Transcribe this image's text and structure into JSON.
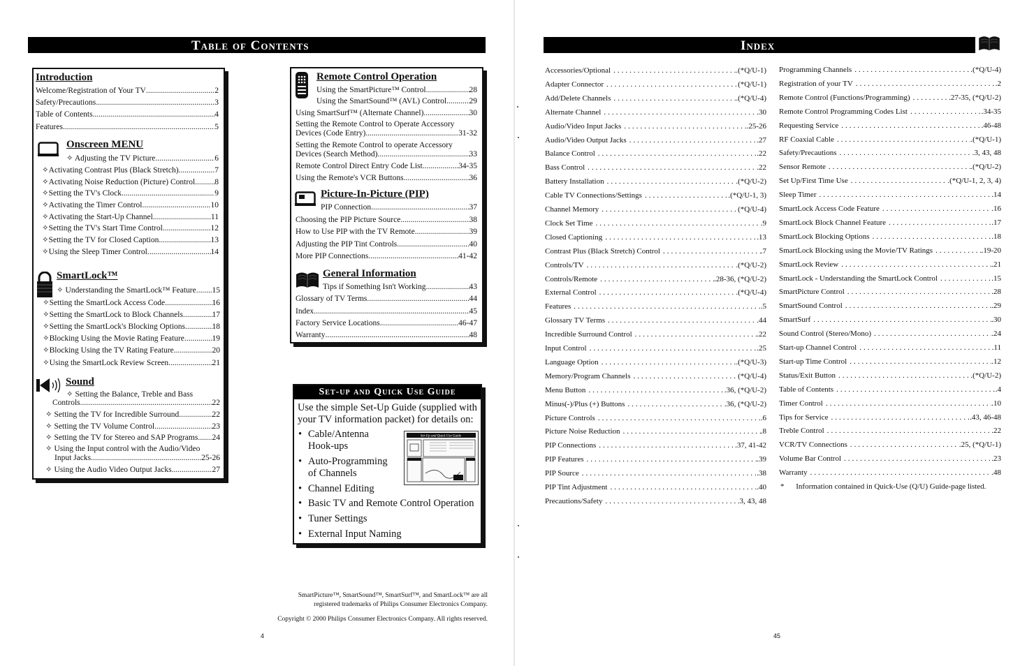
{
  "left_page": {
    "title": "Table of Contents",
    "page_number": "4",
    "sections": {
      "introduction": {
        "heading": "Introduction",
        "items": [
          {
            "label": "Welcome/Registration of Your TV",
            "page": "2"
          },
          {
            "label": "Safety/Precautions ",
            "page": "3"
          },
          {
            "label": "Table of Contents",
            "page": "4"
          },
          {
            "label": "Features",
            "page": "5"
          }
        ]
      },
      "onscreen_menu": {
        "heading": "Onscreen MENU",
        "icon": "tv-screen-icon",
        "items": [
          {
            "label": "✧ Adjusting the TV Picture ",
            "page": "6"
          },
          {
            "label": "✧Activating Contrast Plus (Black Stretch)",
            "page": "7"
          },
          {
            "label": "✧Activating Noise Reduction (Picture) Control ",
            "page": "8"
          },
          {
            "label": "✧Setting the TV's Clock",
            "page": "9"
          },
          {
            "label": "✧Activating the Timer Control",
            "page": "10"
          },
          {
            "label": "✧Activating the Start-Up Channel",
            "page": "11"
          },
          {
            "label": "✧Setting the TV's Start Time Control",
            "page": "12"
          },
          {
            "label": "✧Setting the TV for Closed Caption ",
            "page": "13"
          },
          {
            "label": "✧Using the Sleep Timer Control",
            "page": "14"
          }
        ]
      },
      "smartlock": {
        "heading": "SmartLock™",
        "icon": "padlock-icon",
        "items": [
          {
            "label": "✧ Understanding the SmartLock™ Feature",
            "page": "15"
          },
          {
            "label": "✧Setting the SmartLock Access Code",
            "page": "16"
          },
          {
            "label": "✧Setting the SmartLock  to Block Channels ",
            "page": "17"
          },
          {
            "label": "✧Setting the SmartLock's Blocking Options",
            "page": "18"
          },
          {
            "label": "✧Blocking Using the Movie Rating Feature",
            "page": "19"
          },
          {
            "label": "✧Blocking Using the TV Rating Feature ",
            "page": "20"
          },
          {
            "label": "✧Using the SmartLock Review Screen ",
            "page": "21"
          }
        ]
      },
      "sound": {
        "heading": "Sound",
        "icon": "speaker-icon",
        "first_line": "✧ Setting the Balance, Treble and Bass",
        "items": [
          {
            "label": "Controls",
            "page": "22"
          },
          {
            "label": "✧ Setting the TV for Incredible Surround",
            "page": "22"
          },
          {
            "label": "✧ Setting the TV Volume Control ",
            "page": "23"
          },
          {
            "label": "✧ Setting the TV for Stereo and SAP Programs ",
            "page": "24"
          },
          {
            "label": "Input Jacks ",
            "page": "25-26"
          },
          {
            "label": "✧ Using the Audio Video Output Jacks",
            "page": "27"
          }
        ],
        "wrap_line": "✧ Using the Input control with the Audio/Video"
      },
      "remote_control": {
        "heading": "Remote Control Operation",
        "icon": "remote-control-icon",
        "items": [
          {
            "label": "Using the SmartPicture™ Control ",
            "page": "28"
          },
          {
            "label": "Using the SmartSound™ (AVL) Control ",
            "page": "29"
          },
          {
            "label": "Using SmartSurf™ (Alternate Channel) ",
            "page": "30"
          },
          {
            "label": "Devices (Code Entry) ",
            "page": "31-32"
          },
          {
            "label": "Devices (Search Method) ",
            "page": "33"
          },
          {
            "label": "Remote Control Direct Entry Code List ",
            "page": "34-35"
          },
          {
            "label": "Using the Remote's VCR Buttons",
            "page": "36"
          }
        ],
        "wrap_lines": [
          "Setting the Remote Control to Operate Accessory",
          "Setting the Remote Control to operate Accessory"
        ]
      },
      "pip": {
        "heading": "Picture-In-Picture (PIP)",
        "icon": "pip-screen-icon",
        "items": [
          {
            "label": "PIP Connection ",
            "page": "37"
          },
          {
            "label": "Choosing the PIP Picture Source ",
            "page": "38"
          },
          {
            "label": "How to Use PIP with the TV Remote ",
            "page": "39"
          },
          {
            "label": "Adjusting the PIP Tint Controls ",
            "page": "40"
          },
          {
            "label": "More PIP Connections ",
            "page": "41-42"
          }
        ]
      },
      "general": {
        "heading": "General Information",
        "icon": "open-book-icon",
        "items": [
          {
            "label": "Tips if Something Isn't Working",
            "page": "43"
          },
          {
            "label": "Glossary of TV Terms ",
            "page": "44"
          },
          {
            "label": "Index ",
            "page": "45"
          },
          {
            "label": "Factory Service Locations",
            "page": "46-47"
          },
          {
            "label": "Warranty",
            "page": "48"
          }
        ]
      }
    },
    "setup_guide": {
      "title": "Set-up and Quick Use Guide",
      "intro": "Use the simple Set-Up Guide (supplied with your TV information packet) for details on:",
      "bullets": [
        [
          "Cable/Antenna",
          "Hook-ups"
        ],
        [
          "Auto-Programming",
          "of Channels"
        ],
        [
          "Channel Editing"
        ],
        [
          "Basic TV and Remote Control Operation"
        ],
        [
          "Tuner Settings"
        ],
        [
          "External Input Naming"
        ]
      ],
      "thumbnail_title": "Set-Up and Quick Use Guide"
    },
    "trademarks_line1": "SmartPicture™, SmartSound™, SmartSurf™, and SmartLock™ are all",
    "trademarks_line2": "registered trademarks of  Philips Consumer Electronics Company.",
    "copyright": "Copyright © 2000 Philips Consumer Electronics Company. All rights reserved."
  },
  "right_page": {
    "title": "Index",
    "icon": "open-book-icon",
    "page_number": "45",
    "column1": [
      {
        "label": "Accessories/Optional",
        "page": ".(*Q/U-1)"
      },
      {
        "label": "Adapter Connector",
        "page": " (*Q/U-1)"
      },
      {
        "label": "Add/Delete Channels",
        "page": ".(*Q/U-4)"
      },
      {
        "label": "Alternate Channel",
        "page": ".30"
      },
      {
        "label": "Audio/Video Input Jacks",
        "page": ".25-26"
      },
      {
        "label": "Audio/Video Output Jacks",
        "page": ".27"
      },
      {
        "label": "Balance Control",
        "page": ".22"
      },
      {
        "label": "Bass Control",
        "page": ".22"
      },
      {
        "label": "Battery Installation",
        "page": ".(*Q/U-2)"
      },
      {
        "label": "Cable TV Connections/Settings",
        "page": ".(*Q/U-1, 3)"
      },
      {
        "label": "Channel Memory",
        "page": " (*Q/U-4)"
      },
      {
        "label": "Clock Set Time",
        "page": ".9"
      },
      {
        "label": "Closed Captioning",
        "page": ".13"
      },
      {
        "label": "Contrast Plus (Black Stretch) Control",
        "page": ".7"
      },
      {
        "label": "Controls/TV",
        "page": ".(*Q/U-2)"
      },
      {
        "label": "Controls/Remote",
        "page": ".28-36, (*Q/U-2)"
      },
      {
        "label": "External Control",
        "page": ".(*Q/U-4)"
      },
      {
        "label": "Features",
        "page": ".5"
      },
      {
        "label": "Glossary TV Terms",
        "page": ".44"
      },
      {
        "label": "Incredible Surround Control",
        "page": ".22"
      },
      {
        "label": "Input Control",
        "page": ".25"
      },
      {
        "label": "Language Option",
        "page": ".(*Q/U-3)"
      },
      {
        "label": "Memory/Program Channels",
        "page": " (*Q/U-4)"
      },
      {
        "label": "Menu Button",
        "page": ".36, (*Q/U-2)"
      },
      {
        "label": "Minus(-)/Plus (+) Buttons",
        "page": ".36, (*Q/U-2)"
      },
      {
        "label": "Picture Controls",
        "page": ".6"
      },
      {
        "label": "Picture Noise Reduction",
        "page": ".8"
      },
      {
        "label": "PIP Connections",
        "page": ".37, 41-42"
      },
      {
        "label": "PIP Features",
        "page": ".39"
      },
      {
        "label": "PIP Source",
        "page": ".38"
      },
      {
        "label": "PIP Tint Adjustment",
        "page": ".40"
      },
      {
        "label": "Precautions/Safety",
        "page": ".3, 43, 48"
      }
    ],
    "column2": [
      {
        "label": "Programming Channels",
        "page": ".(*Q/U-4)"
      },
      {
        "label": "Registration of your TV",
        "page": ".2"
      },
      {
        "label": "Remote Control (Functions/Programming)",
        "page": ".27-35, (*Q/U-2)"
      },
      {
        "label": "Remote Control Programming Codes List",
        "page": ".34-35"
      },
      {
        "label": "Requesting Service",
        "page": ".46-48"
      },
      {
        "label": "RF Coaxial Cable",
        "page": ".(*Q/U-1)"
      },
      {
        "label": "Safety/Precautions",
        "page": ".3, 43, 48"
      },
      {
        "label": "Sensor Remote",
        "page": ".(*Q/U-2)"
      },
      {
        "label": "Set Up/First Time Use",
        "page": ".(*Q/U-1, 2, 3, 4)"
      },
      {
        "label": "Sleep Timer",
        "page": ".14"
      },
      {
        "label": "SmartLock Access Code Feature",
        "page": ".16"
      },
      {
        "label": "SmartLock Block Channel Feature",
        "page": ".17"
      },
      {
        "label": "SmartLock Blocking Options",
        "page": ".18"
      },
      {
        "label": "SmartLock Blocking using the Movie/TV Ratings",
        "page": ".19-20"
      },
      {
        "label": "SmartLock Review",
        "page": ".21"
      },
      {
        "label": "SmartLock - Understanding the SmartLock Control",
        "page": ".15"
      },
      {
        "label": "SmartPicture Control",
        "page": ".28"
      },
      {
        "label": "SmartSound Control",
        "page": ".29"
      },
      {
        "label": "SmartSurf",
        "page": ".30"
      },
      {
        "label": "Sound Control (Stereo/Mono)",
        "page": ".24"
      },
      {
        "label": "Start-up Channel Control",
        "page": ".11"
      },
      {
        "label": "Start-up Time Control",
        "page": ".12"
      },
      {
        "label": "Status/Exit Button",
        "page": ".(*Q/U-2)"
      },
      {
        "label": "Table of Contents",
        "page": ".4"
      },
      {
        "label": "Timer Control",
        "page": ".10"
      },
      {
        "label": "Tips for Service",
        "page": ".43, 46-48"
      },
      {
        "label": "Treble Control",
        "page": ".22"
      },
      {
        "label": "VCR/TV Connections",
        "page": ".25, (*Q/U-1)"
      },
      {
        "label": "Volume Bar Control",
        "page": ".23"
      },
      {
        "label": "Warranty",
        "page": ".48"
      }
    ],
    "footnote_marker": "*",
    "footnote": "Information contained in Quick-Use (Q/U) Guide-page listed."
  }
}
